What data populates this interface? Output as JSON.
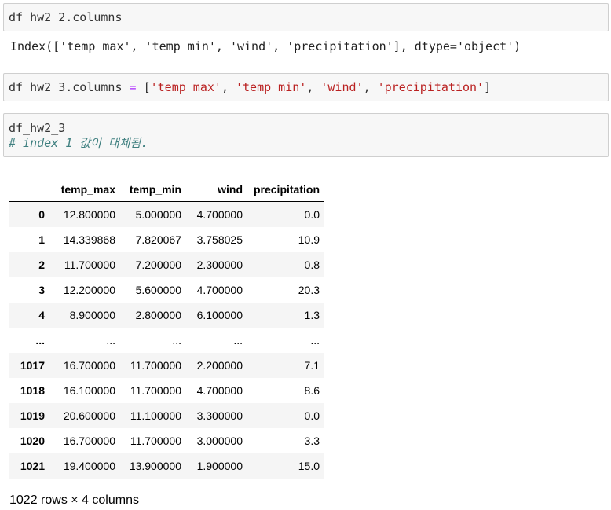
{
  "cells": {
    "cell1": {
      "code": "df_hw2_2.columns"
    },
    "output1": {
      "text": "Index(['temp_max', 'temp_min', 'wind', 'precipitation'], dtype='object')"
    },
    "cell2": {
      "var": "df_hw2_3.columns ",
      "op": "=",
      "lbr": " [",
      "s1": "'temp_max'",
      "sep": ", ",
      "s2": "'temp_min'",
      "s3": "'wind'",
      "s4": "'precipitation'",
      "rbr": "]"
    },
    "cell3": {
      "code": "df_hw2_3",
      "comment": "# index 1 값이 대체됨."
    }
  },
  "table": {
    "columns": [
      "",
      "temp_max",
      "temp_min",
      "wind",
      "precipitation"
    ],
    "rows": [
      [
        "0",
        "12.800000",
        "5.000000",
        "4.700000",
        "0.0"
      ],
      [
        "1",
        "14.339868",
        "7.820067",
        "3.758025",
        "10.9"
      ],
      [
        "2",
        "11.700000",
        "7.200000",
        "2.300000",
        "0.8"
      ],
      [
        "3",
        "12.200000",
        "5.600000",
        "4.700000",
        "20.3"
      ],
      [
        "4",
        "8.900000",
        "2.800000",
        "6.100000",
        "1.3"
      ],
      [
        "...",
        "...",
        "...",
        "...",
        "..."
      ],
      [
        "1017",
        "16.700000",
        "11.700000",
        "2.200000",
        "7.1"
      ],
      [
        "1018",
        "16.100000",
        "11.700000",
        "4.700000",
        "8.6"
      ],
      [
        "1019",
        "20.600000",
        "11.100000",
        "3.300000",
        "0.0"
      ],
      [
        "1020",
        "16.700000",
        "11.700000",
        "3.000000",
        "3.3"
      ],
      [
        "1021",
        "19.400000",
        "13.900000",
        "1.900000",
        "15.0"
      ]
    ]
  },
  "footer": {
    "text": "1022 rows × 4 columns"
  }
}
